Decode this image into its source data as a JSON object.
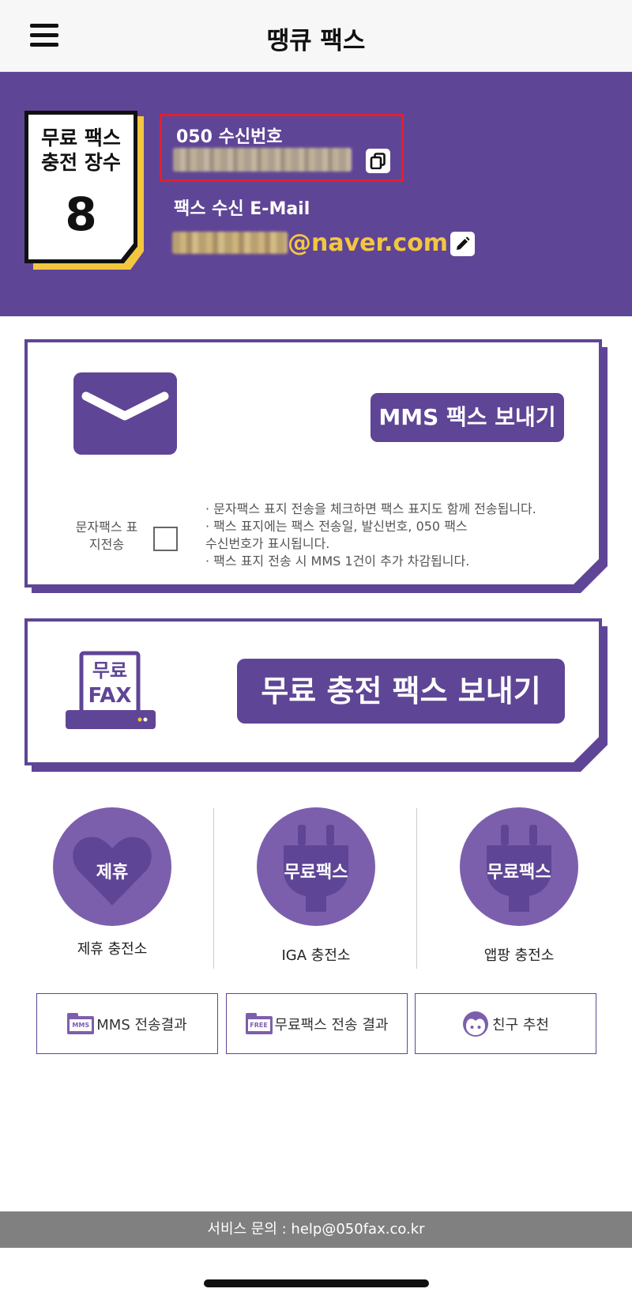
{
  "header": {
    "title": "땡큐 팩스",
    "menu_icon": "hamburger-menu-icon"
  },
  "banner": {
    "charge_label": "무료 팩스 충전 장수",
    "charge_count": "8",
    "number_label": "050 수신번호",
    "number_value_masked": true,
    "email_label": "팩스 수신 E-Mail",
    "email_domain": "@naver.com",
    "copy_icon": "copy-icon",
    "edit_icon": "pencil-icon",
    "colors": {
      "background": "#5f4596",
      "accent": "#f3c63f",
      "highlight_border": "#e0202f"
    }
  },
  "mms_card": {
    "envelope_icon": "envelope-icon",
    "send_button": "MMS 팩스 보내기",
    "cover_label": "문자팩스 표지전송",
    "cover_checked": false,
    "notes": [
      "· 문자팩스 표지 전송을 체크하면 팩스 표지도 함께 전송됩니다.",
      "· 팩스 표지에는 팩스 전송일, 발신번호, 050 팩스",
      "  수신번호가 표시됩니다.",
      "· 팩스 표지 전송 시 MMS 1건이 추가 차감됩니다."
    ]
  },
  "free_card": {
    "fax_icon_line1": "무료",
    "fax_icon_line2": "FAX",
    "send_button": "무료 충전 팩스 보내기"
  },
  "stations": [
    {
      "badge": "제휴",
      "name": "제휴 충전소",
      "icon": "handshake-icon"
    },
    {
      "badge": "무료팩스",
      "name": "IGA 충전소",
      "icon": "plug-icon"
    },
    {
      "badge": "무료팩스",
      "name": "앱팡 충전소",
      "icon": "plug-icon"
    }
  ],
  "bottom_buttons": [
    {
      "label": "MMS 전송결과",
      "icon_text": "MMS",
      "icon": "folder-icon"
    },
    {
      "label": "무료팩스 전송 결과",
      "icon_text": "FREE",
      "icon": "folder-icon"
    },
    {
      "label": "친구 추천",
      "icon": "face-icon"
    }
  ],
  "footer": {
    "text": "서비스 문의 : help@050fax.co.kr"
  }
}
